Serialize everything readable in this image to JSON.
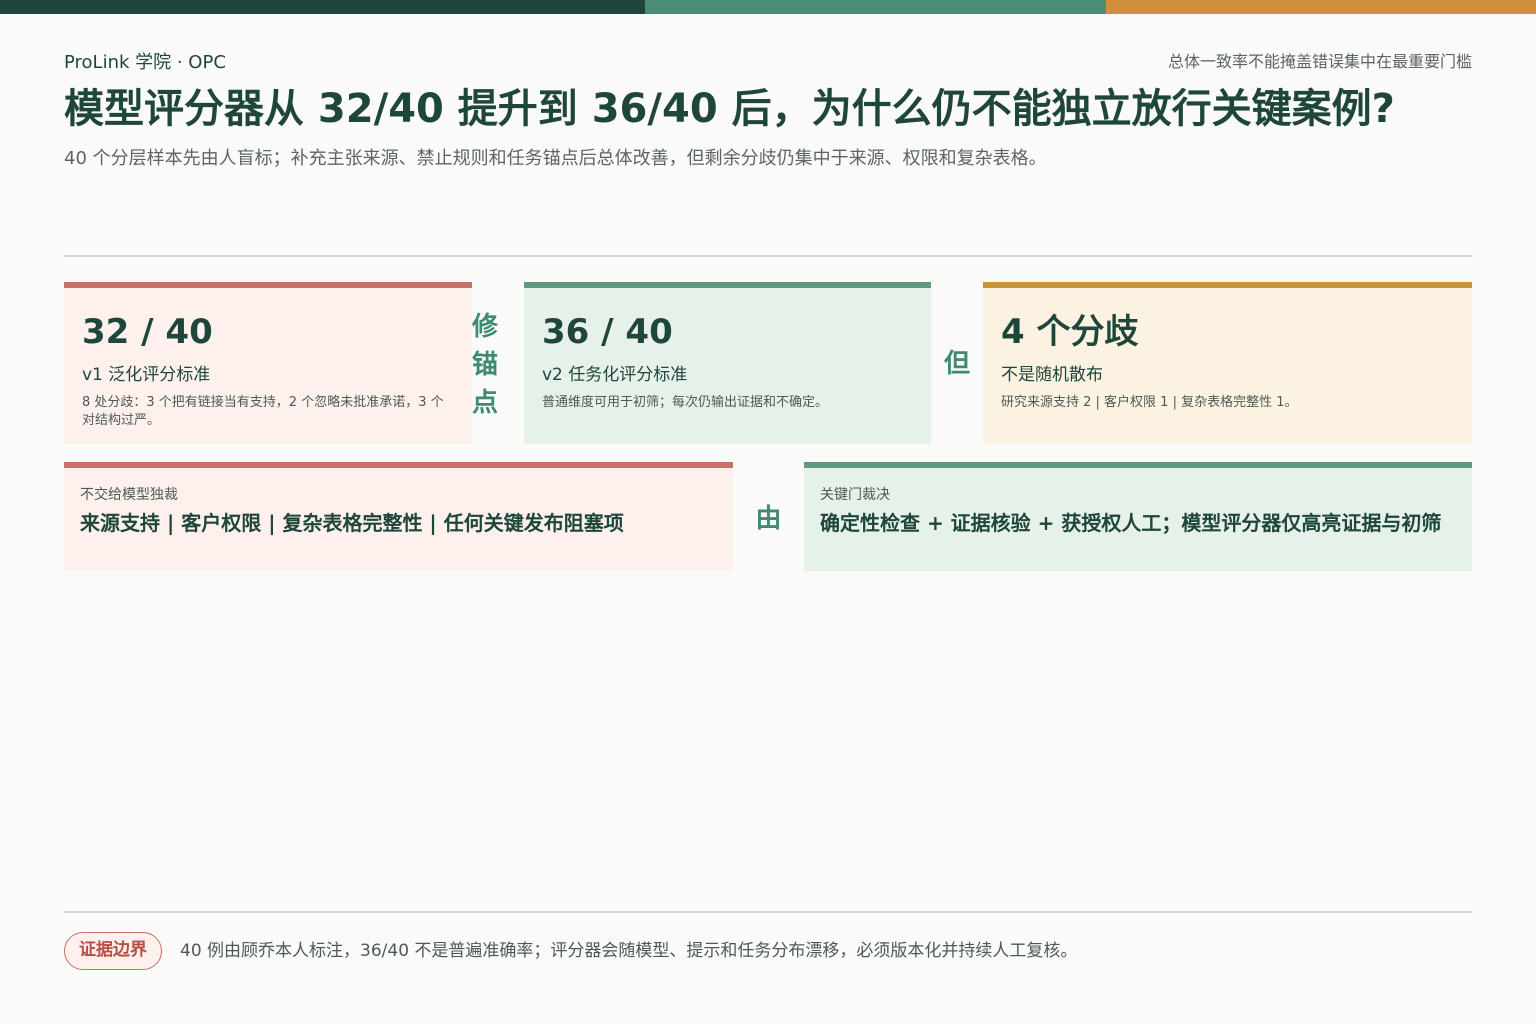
{
  "header": {
    "brand": "ProLink 学院 · OPC",
    "tagline": "总体一致率不能掩盖错误集中在最重要门槛",
    "title": "模型评分器从 32/40 提升到 36/40 后，为什么仍不能独立放行关键案例?",
    "subtitle": "40 个分层样本先由人盲标；补充主张来源、禁止规则和任务锚点后总体改善，但剩余分歧仍集中于来源、权限和复杂表格。"
  },
  "cards": [
    {
      "big": "32 / 40",
      "sub": "v1 泛化评分标准",
      "note": "8 处分歧：3 个把有链接当有支持，2 个忽略未批准承诺，3 个对结构过严。"
    },
    {
      "big": "36 / 40",
      "sub": "v2 任务化评分标准",
      "note": "普通维度可用于初筛；每次仍输出证据和不确定。"
    },
    {
      "big": "4 个分歧",
      "sub": "不是随机散布",
      "note": "研究来源支持 2 | 客户权限 1 | 复杂表格完整性 1。"
    }
  ],
  "connectors": {
    "fix": "修锚点",
    "but": "但",
    "by": "由"
  },
  "panels": [
    {
      "title": "不交给模型独裁",
      "body": "来源支持 | 客户权限 | 复杂表格完整性 | 任何关键发布阻塞项"
    },
    {
      "title": "关键门裁决",
      "body": "确定性检查 + 证据核验 + 获授权人工；模型评分器仅高亮证据与初筛"
    }
  ],
  "footer": {
    "badge": "证据边界",
    "note": "40 例由顾乔本人标注，36/40 不是普遍准确率；评分器会随模型、提示和任务分布漂移，必须版本化并持续人工复核。"
  },
  "colors": {
    "dark_green": "#1f463b",
    "green": "#4b8c76",
    "orange": "#cf8f3c",
    "red": "#c8706a"
  }
}
